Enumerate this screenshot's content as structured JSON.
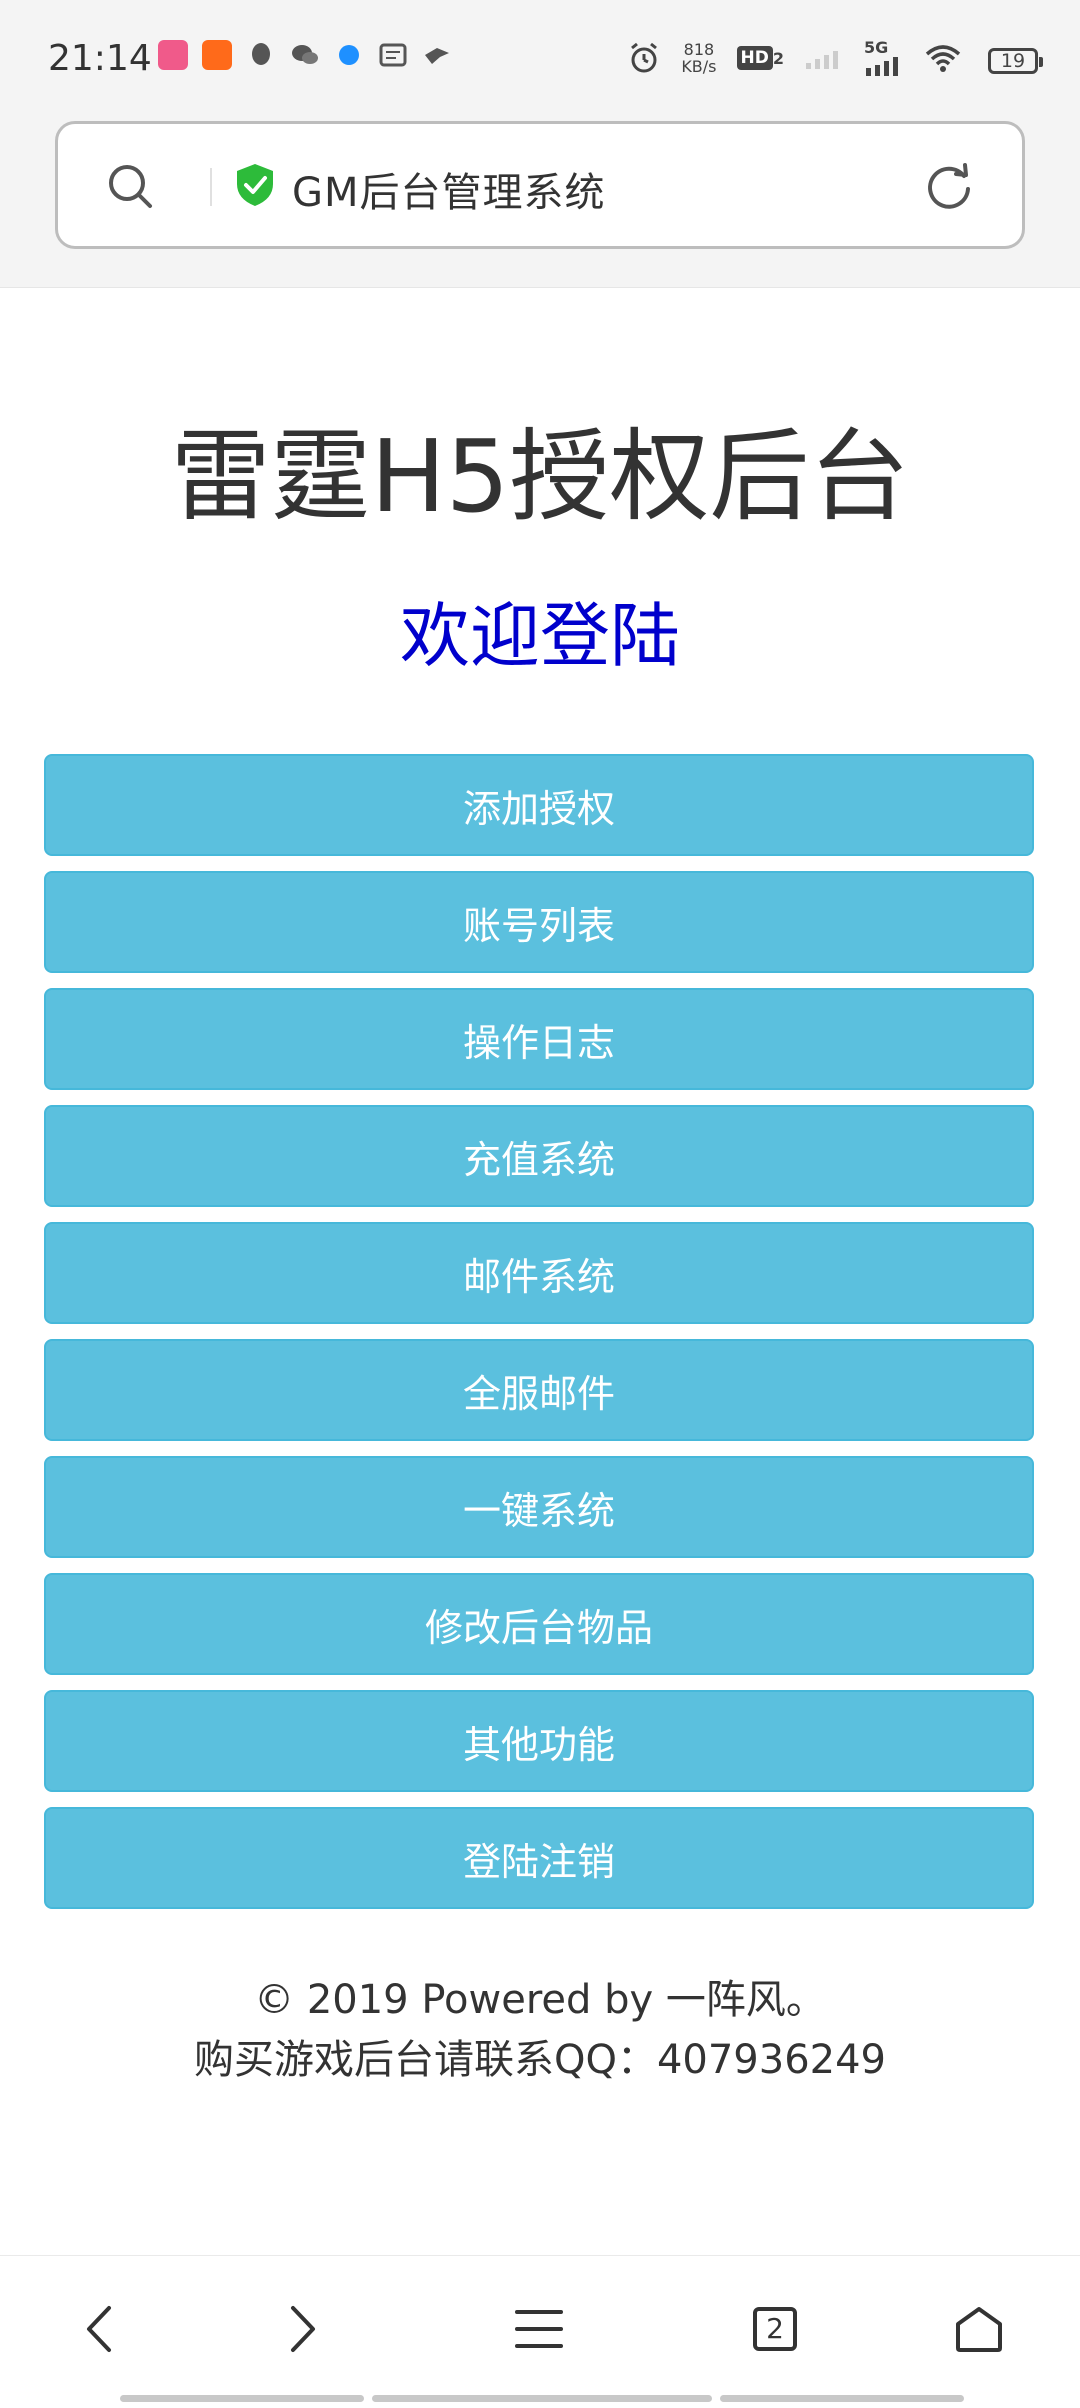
{
  "status_bar": {
    "time": "21:14",
    "network_speed_value": "818",
    "network_speed_unit": "KB/s",
    "hd_label": "HD",
    "hd_sub": "2",
    "network_type": "5G",
    "battery": "19",
    "app_icons": [
      "video-app-icon",
      "kuaishou-icon",
      "qq-icon",
      "wechat-icon",
      "blue-app-icon",
      "message-icon",
      "bird-icon"
    ]
  },
  "address_bar": {
    "title": "GM后台管理系统"
  },
  "page": {
    "title": "雷霆H5授权后台",
    "welcome": "欢迎登陆",
    "welcome_color": "#0000cc",
    "button_color": "#5bc0de",
    "menu": [
      {
        "label": "添加授权"
      },
      {
        "label": "账号列表"
      },
      {
        "label": "操作日志"
      },
      {
        "label": "充值系统"
      },
      {
        "label": "邮件系统"
      },
      {
        "label": "全服邮件"
      },
      {
        "label": "一键系统"
      },
      {
        "label": "修改后台物品"
      },
      {
        "label": "其他功能"
      },
      {
        "label": "登陆注销"
      }
    ],
    "footer_line1": "© 2019 Powered by 一阵风。",
    "footer_line2": "购买游戏后台请联系QQ：407936249"
  },
  "bottom_nav": {
    "tabs_count": "2"
  }
}
